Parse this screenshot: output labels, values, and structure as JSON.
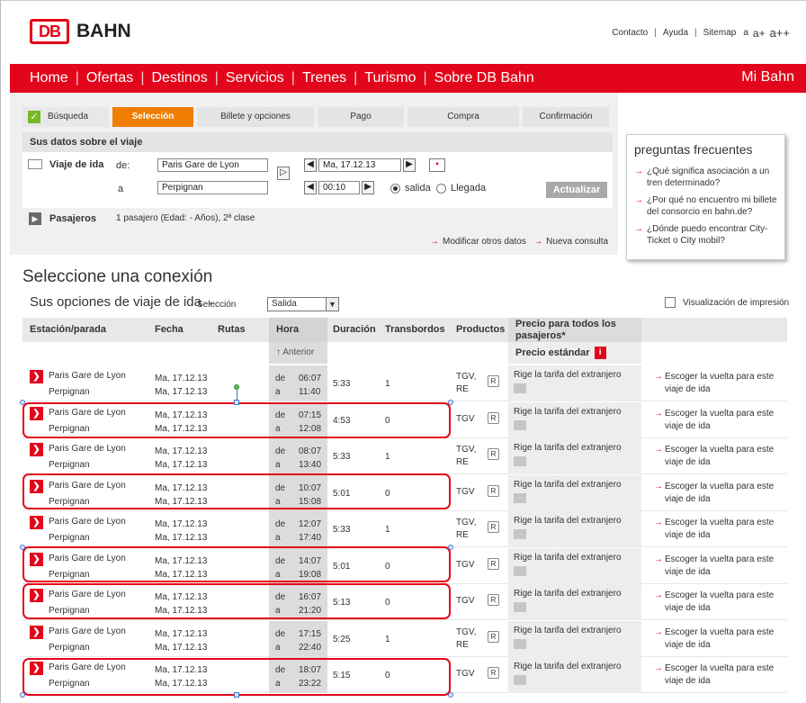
{
  "header": {
    "logo_db": "DB",
    "logo_bahn": "BAHN",
    "links": [
      "Contacto",
      "Ayuda",
      "Sitemap"
    ],
    "font_sizes": [
      "a",
      "a+",
      "a++"
    ]
  },
  "nav": {
    "items": [
      "Home",
      "Ofertas",
      "Destinos",
      "Servicios",
      "Trenes",
      "Turismo",
      "Sobre DB Bahn"
    ],
    "right": "Mi Bahn"
  },
  "steps": [
    "Búsqueda",
    "Selección",
    "Billete y opciones",
    "Pago",
    "Compra",
    "Confirmación"
  ],
  "trip": {
    "heading": "Sus datos sobre el viaje",
    "label_ida": "Viaje de ida",
    "de_label": "de:",
    "a_label": "a",
    "from": "Paris Gare de Lyon",
    "to": "Perpignan",
    "date": "Ma, 17.12.13",
    "time": "00:10",
    "salida": "salida",
    "llegada": "Llegada",
    "update_btn": "Actualizar",
    "pasajeros_label": "Pasajeros",
    "pasajeros_value": "1 pasajero (Edad: - Años), 2ª clase"
  },
  "mod_links": [
    "Modificar otros datos",
    "Nueva consulta"
  ],
  "faq": {
    "title": "preguntas frecuentes",
    "items": [
      "¿Qué significa asociación a un tren determinado?",
      "¿Por qué no encuentro mi billete del consorcio en bahn.de?",
      "¿Dónde puedo encontrar City-Ticket o City mobil?"
    ]
  },
  "results": {
    "title": "Seleccione una conexión",
    "subtitle": "Sus opciones de viaje de ida",
    "subtitle_dash": "-",
    "subtitle_small": "Selección",
    "select_value": "Salida",
    "print": "Visualización de impresión",
    "columns": {
      "station": "Estación/parada",
      "date": "Fecha",
      "routes": "Rutas",
      "time": "Hora",
      "duration": "Duración",
      "transfers": "Transbordos",
      "products": "Productos",
      "price": "Precio para todos los pasajeros*"
    },
    "anterior": "↑ Anterior",
    "precio_estandar": "Precio estándar",
    "price_text": "Rige la tarifa del extranjero",
    "escoger": "Escoger la vuelta para este viaje de ida",
    "de": "de",
    "a": "a",
    "rows": [
      {
        "from": "Paris Gare de Lyon",
        "to": "Perpignan",
        "d1": "Ma, 17.12.13",
        "d2": "Ma, 17.12.13",
        "dep": "06:07",
        "arr": "11:40",
        "dur": "5:33",
        "tr": "1",
        "prod": "TGV, RE"
      },
      {
        "from": "Paris Gare de Lyon",
        "to": "Perpignan",
        "d1": "Ma, 17.12.13",
        "d2": "Ma, 17.12.13",
        "dep": "07:15",
        "arr": "12:08",
        "dur": "4:53",
        "tr": "0",
        "prod": "TGV"
      },
      {
        "from": "Paris Gare de Lyon",
        "to": "Perpignan",
        "d1": "Ma, 17.12.13",
        "d2": "Ma, 17.12.13",
        "dep": "08:07",
        "arr": "13:40",
        "dur": "5:33",
        "tr": "1",
        "prod": "TGV, RE"
      },
      {
        "from": "Paris Gare de Lyon",
        "to": "Perpignan",
        "d1": "Ma, 17.12.13",
        "d2": "Ma, 17.12.13",
        "dep": "10:07",
        "arr": "15:08",
        "dur": "5:01",
        "tr": "0",
        "prod": "TGV"
      },
      {
        "from": "Paris Gare de Lyon",
        "to": "Perpignan",
        "d1": "Ma, 17.12.13",
        "d2": "Ma, 17.12.13",
        "dep": "12:07",
        "arr": "17:40",
        "dur": "5:33",
        "tr": "1",
        "prod": "TGV, RE"
      },
      {
        "from": "Paris Gare de Lyon",
        "to": "Perpignan",
        "d1": "Ma, 17.12.13",
        "d2": "Ma, 17.12.13",
        "dep": "14:07",
        "arr": "19:08",
        "dur": "5:01",
        "tr": "0",
        "prod": "TGV"
      },
      {
        "from": "Paris Gare de Lyon",
        "to": "Perpignan",
        "d1": "Ma, 17.12.13",
        "d2": "Ma, 17.12.13",
        "dep": "16:07",
        "arr": "21:20",
        "dur": "5:13",
        "tr": "0",
        "prod": "TGV"
      },
      {
        "from": "Paris Gare de Lyon",
        "to": "Perpignan",
        "d1": "Ma, 17.12.13",
        "d2": "Ma, 17.12.13",
        "dep": "17:15",
        "arr": "22:40",
        "dur": "5:25",
        "tr": "1",
        "prod": "TGV, RE"
      },
      {
        "from": "Paris Gare de Lyon",
        "to": "Perpignan",
        "d1": "Ma, 17.12.13",
        "d2": "Ma, 17.12.13",
        "dep": "18:07",
        "arr": "23:22",
        "dur": "5:15",
        "tr": "0",
        "prod": "TGV"
      }
    ]
  },
  "colors": {
    "brand_red": "#e3051b",
    "active_step": "#ef7d00",
    "done_check": "#78b82a"
  }
}
